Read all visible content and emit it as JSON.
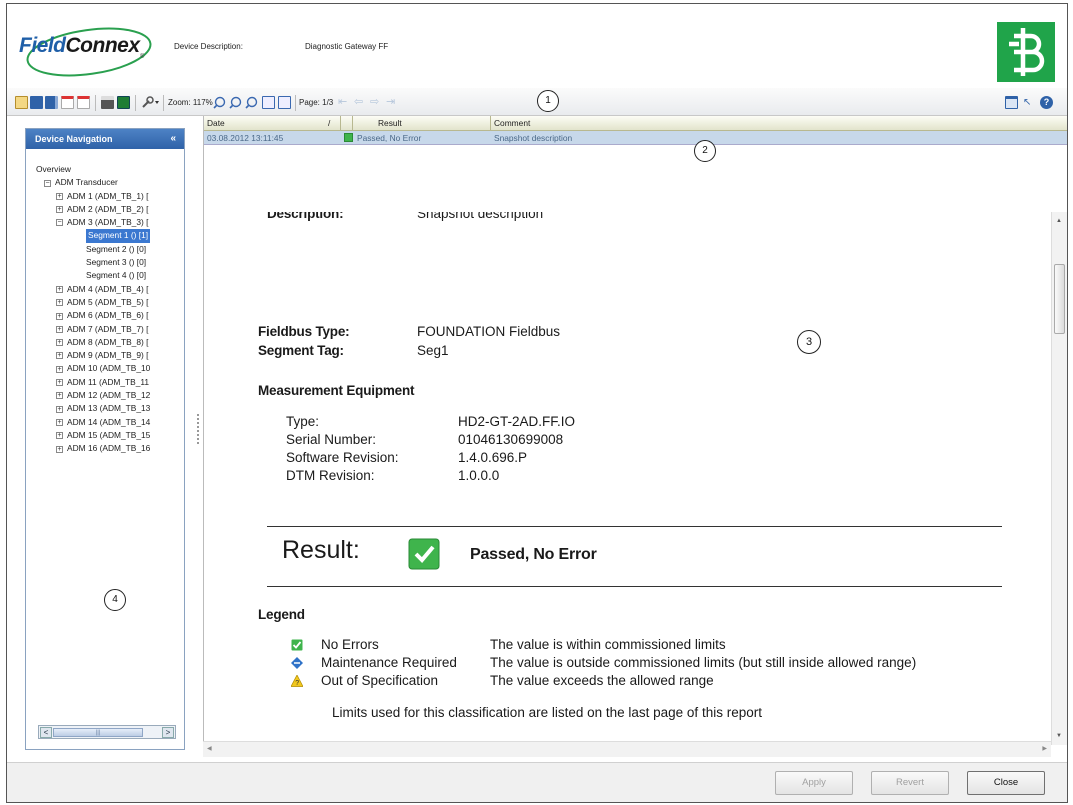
{
  "header": {
    "logo_text_field": "Field",
    "logo_text_connex": "Connex",
    "logo_registered": "®",
    "device_description_label": "Device Description:",
    "device_description_value": "Diagnostic Gateway FF"
  },
  "toolbar": {
    "zoom": "Zoom: 117%",
    "page": "Page: 1/3"
  },
  "callouts": [
    "1",
    "2",
    "3",
    "4"
  ],
  "nav": {
    "title": "Device Navigation",
    "collapse_glyph": "«",
    "items": [
      {
        "label": "Overview",
        "level": 0
      },
      {
        "label": "ADM Transducer",
        "level": 1,
        "expander": "−"
      },
      {
        "label": "ADM 1 (ADM_TB_1) [",
        "level": 2,
        "expander": "+"
      },
      {
        "label": "ADM 2 (ADM_TB_2) [",
        "level": 2,
        "expander": "+"
      },
      {
        "label": "ADM 3 (ADM_TB_3) [",
        "level": 2,
        "expander": "−"
      },
      {
        "label": "Segment 1 () [1]",
        "level": 3,
        "selected": true
      },
      {
        "label": "Segment 2 () [0]",
        "level": 3
      },
      {
        "label": "Segment 3 () [0]",
        "level": 3
      },
      {
        "label": "Segment 4 () [0]",
        "level": 3
      },
      {
        "label": "ADM 4 (ADM_TB_4) [",
        "level": 2,
        "expander": "+"
      },
      {
        "label": "ADM 5 (ADM_TB_5) [",
        "level": 2,
        "expander": "+"
      },
      {
        "label": "ADM 6 (ADM_TB_6) [",
        "level": 2,
        "expander": "+"
      },
      {
        "label": "ADM 7 (ADM_TB_7) [",
        "level": 2,
        "expander": "+"
      },
      {
        "label": "ADM 8 (ADM_TB_8) [",
        "level": 2,
        "expander": "+"
      },
      {
        "label": "ADM 9 (ADM_TB_9) [",
        "level": 2,
        "expander": "+"
      },
      {
        "label": "ADM 10 (ADM_TB_10",
        "level": 2,
        "expander": "+"
      },
      {
        "label": "ADM 11 (ADM_TB_11",
        "level": 2,
        "expander": "+"
      },
      {
        "label": "ADM 12 (ADM_TB_12",
        "level": 2,
        "expander": "+"
      },
      {
        "label": "ADM 13 (ADM_TB_13",
        "level": 2,
        "expander": "+"
      },
      {
        "label": "ADM 14 (ADM_TB_14",
        "level": 2,
        "expander": "+"
      },
      {
        "label": "ADM 15 (ADM_TB_15",
        "level": 2,
        "expander": "+"
      },
      {
        "label": "ADM 16 (ADM_TB_16",
        "level": 2,
        "expander": "+"
      }
    ],
    "scroll_left": "<",
    "scroll_right": ">",
    "scroll_grip": "|||"
  },
  "grid": {
    "col_date": "Date",
    "col_sort": "/",
    "col_result": "Result",
    "col_comment": "Comment",
    "row": {
      "date": "03.08.2012 13:11:45",
      "result": "Passed, No Error",
      "comment": "Snapshot description"
    }
  },
  "report": {
    "description_label": "Description:",
    "description_value": "Snapshot description",
    "fieldbus_type_label": "Fieldbus Type:",
    "fieldbus_type_value": "FOUNDATION Fieldbus",
    "segment_tag_label": "Segment Tag:",
    "segment_tag_value": "Seg1",
    "measurement_heading": "Measurement Equipment",
    "equipment": [
      {
        "label": "Type:",
        "value": "HD2-GT-2AD.FF.IO"
      },
      {
        "label": "Serial Number:",
        "value": "01046130699008"
      },
      {
        "label": "Software Revision:",
        "value": "1.4.0.696.P"
      },
      {
        "label": "DTM Revision:",
        "value": "1.0.0.0"
      }
    ],
    "result_label": "Result:",
    "result_value": "Passed, No Error",
    "legend_heading": "Legend",
    "legend": [
      {
        "name": "No Errors",
        "desc": "The value is within commissioned limits",
        "icon": "green-check-icon"
      },
      {
        "name": "Maintenance Required",
        "desc": "The value is outside commissioned limits (but still inside allowed range)",
        "icon": "blue-diamond-icon"
      },
      {
        "name": "Out of Specification",
        "desc": "The value exceeds the allowed range",
        "icon": "yellow-warning-icon"
      }
    ],
    "limits_note": "Limits used for this classification are listed on the last page of this report"
  },
  "buttons": {
    "apply": "Apply",
    "revert": "Revert",
    "close": "Close"
  },
  "colors": {
    "accent_blue": "#2f62a8",
    "pf_green": "#20a44a",
    "selection": "#c7d8ea",
    "pass_green": "#3fb44c"
  }
}
